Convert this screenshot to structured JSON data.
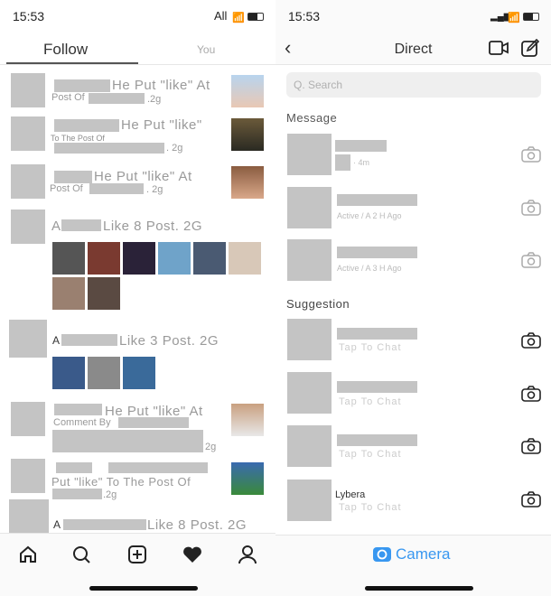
{
  "left": {
    "status": {
      "time": "15:53",
      "carrier": "All"
    },
    "tabs": [
      {
        "label": "Follow",
        "active": true
      },
      {
        "label": "You",
        "active": false
      }
    ],
    "rows": [
      {
        "line1": "He Put \"like\" At",
        "line2": "Post Of",
        "time": ".2g"
      },
      {
        "line1": "He Put \"like\"",
        "line2": "To The Post Of",
        "time": ". 2g"
      },
      {
        "line1": "He Put \"like\" At",
        "line2": "Post Of",
        "time": ". 2g"
      },
      {
        "prefix": "A",
        "line1": "Like 8 Post. 2G"
      },
      {
        "prefix": "A",
        "line1": "Like 3 Post. 2G"
      },
      {
        "line1": "He Put \"like\" At",
        "line2": "Comment By",
        "time": "2g"
      },
      {
        "line2": "Put \"like\" To The Post Of",
        "time": ".2g"
      },
      {
        "prefix": "A",
        "line1": "Like 8 Post. 2G"
      }
    ],
    "nav": [
      "home-icon",
      "search-icon",
      "add-icon",
      "heart-icon",
      "profile-icon"
    ]
  },
  "right": {
    "status": {
      "time": "15:53"
    },
    "title": "Direct",
    "search_placeholder": "Q. Search",
    "message_header": "Message",
    "messages": [
      {
        "sub": "· 4m"
      },
      {
        "sub": "Active / A 2 H Ago"
      },
      {
        "sub": "Active / A 3 H Ago"
      }
    ],
    "suggestion_header": "Suggestion",
    "suggestions": [
      {
        "name": "",
        "sub": "Tap To Chat"
      },
      {
        "name": "",
        "sub": "Tap To Chat"
      },
      {
        "name": "",
        "sub": "Tap To Chat"
      },
      {
        "name": "Lybera",
        "sub": "Tap To Chat"
      }
    ],
    "camera_label": "Camera",
    "accent": "#3897f0"
  }
}
